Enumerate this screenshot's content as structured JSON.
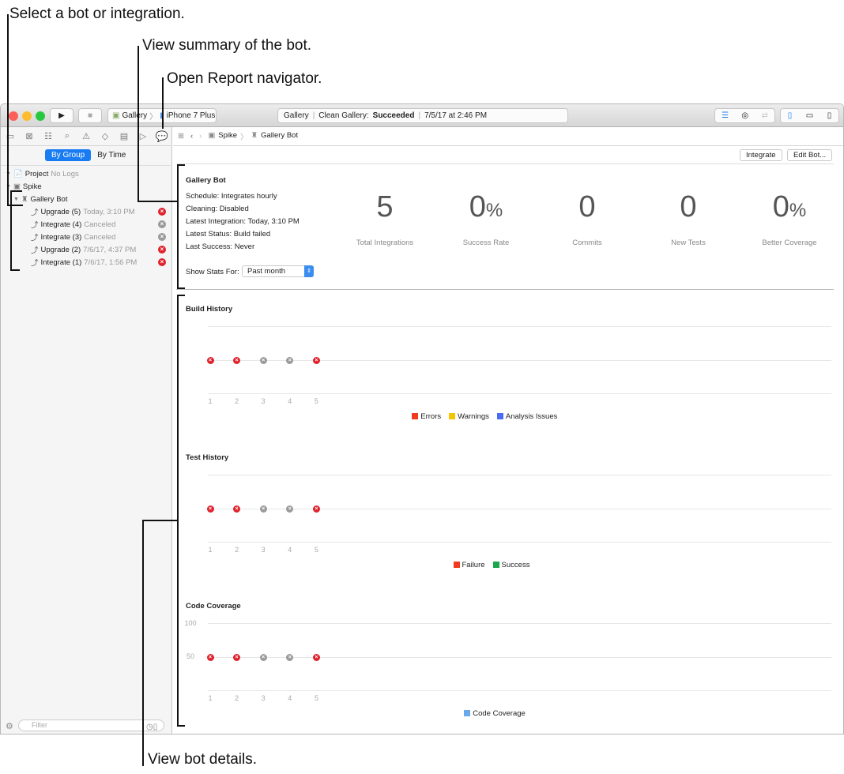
{
  "callouts": {
    "select": "Select a bot or integration.",
    "summary": "View summary of the bot.",
    "report": "Open Report navigator.",
    "details": "View bot details."
  },
  "toolbar": {
    "scheme": "Gallery",
    "device": "iPhone 7 Plus",
    "activity_project": "Gallery",
    "activity_action": "Clean Gallery:",
    "activity_status": "Succeeded",
    "activity_time": "7/5/17 at 2:46 PM"
  },
  "navigator": {
    "seg_group": "By Group",
    "seg_time": "By Time",
    "filter_placeholder": "Filter",
    "tree": [
      {
        "label": "Project",
        "sub": "No Logs"
      },
      {
        "label": "Spike",
        "sub": ""
      },
      {
        "label": "Gallery Bot",
        "sub": ""
      },
      {
        "label": "Upgrade (5)",
        "sub": "Today, 3:10 PM",
        "status": "error"
      },
      {
        "label": "Integrate (4)",
        "sub": "Canceled",
        "status": "canceled"
      },
      {
        "label": "Integrate (3)",
        "sub": "Canceled",
        "status": "canceled"
      },
      {
        "label": "Upgrade (2)",
        "sub": "7/6/17, 4:37 PM",
        "status": "error"
      },
      {
        "label": "Integrate (1)",
        "sub": "7/6/17, 1:56 PM",
        "status": "error"
      }
    ]
  },
  "jumpbar": {
    "crumb1": "Spike",
    "crumb2": "Gallery Bot"
  },
  "actions": {
    "integrate": "Integrate",
    "edit": "Edit Bot..."
  },
  "summary": {
    "title": "Gallery Bot",
    "schedule": "Schedule: Integrates hourly",
    "cleaning": "Cleaning: Disabled",
    "latest_integration": "Latest Integration: Today, 3:10 PM",
    "latest_status": "Latest Status: Build failed",
    "last_success": "Last Success: Never",
    "stats_label": "Show Stats For:",
    "stats_value": "Past month",
    "stats": [
      {
        "value": "5",
        "unit": "",
        "label": "Total Integrations"
      },
      {
        "value": "0",
        "unit": "%",
        "label": "Success Rate"
      },
      {
        "value": "0",
        "unit": "",
        "label": "Commits"
      },
      {
        "value": "0",
        "unit": "",
        "label": "New Tests"
      },
      {
        "value": "0",
        "unit": "%",
        "label": "Better Coverage"
      }
    ]
  },
  "colors": {
    "error": "#e0222c",
    "canceled": "#9a9a9a",
    "accent": "#1a7cf2"
  },
  "chart_data": [
    {
      "type": "scatter",
      "title": "Build History",
      "x": [
        1,
        2,
        3,
        4,
        5
      ],
      "status": [
        "error",
        "error",
        "canceled",
        "canceled",
        "error"
      ],
      "legend": [
        {
          "label": "Errors",
          "color": "#f03c1e"
        },
        {
          "label": "Warnings",
          "color": "#f5c400"
        },
        {
          "label": "Analysis Issues",
          "color": "#4a6cf0"
        }
      ]
    },
    {
      "type": "scatter",
      "title": "Test History",
      "x": [
        1,
        2,
        3,
        4,
        5
      ],
      "status": [
        "error",
        "error",
        "canceled",
        "canceled",
        "error"
      ],
      "legend": [
        {
          "label": "Failure",
          "color": "#f03c1e"
        },
        {
          "label": "Success",
          "color": "#1aa64a"
        }
      ]
    },
    {
      "type": "scatter",
      "title": "Code Coverage",
      "x": [
        1,
        2,
        3,
        4,
        5
      ],
      "y_ticks": [
        "100",
        "50"
      ],
      "ylim": [
        0,
        100
      ],
      "status": [
        "error",
        "error",
        "canceled",
        "canceled",
        "error"
      ],
      "legend": [
        {
          "label": "Code Coverage",
          "color": "#6aa8e8"
        }
      ]
    }
  ]
}
